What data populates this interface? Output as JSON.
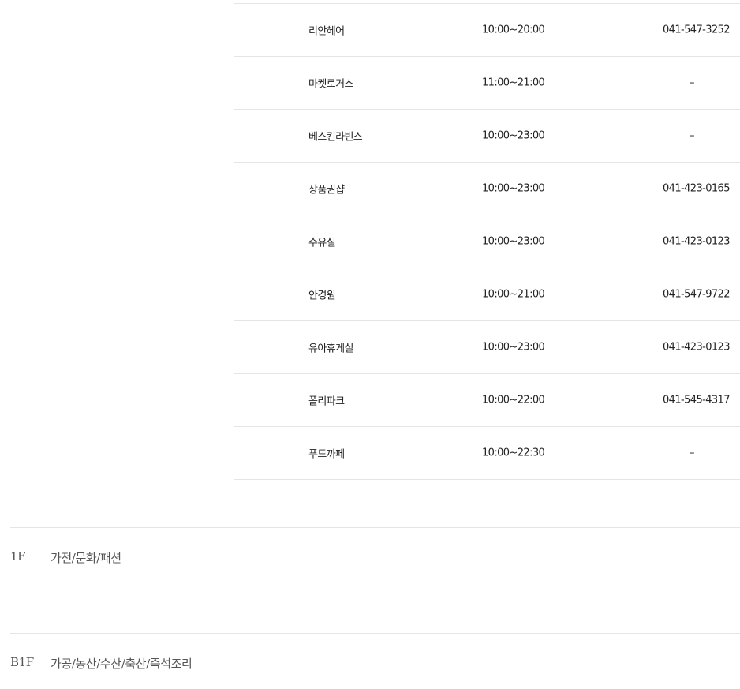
{
  "stores": [
    {
      "name": "리안헤어",
      "hours": "10:00~20:00",
      "phone": "041-547-3252"
    },
    {
      "name": "마켓로거스",
      "hours": "11:00~21:00",
      "phone": "–"
    },
    {
      "name": "베스킨라빈스",
      "hours": "10:00~23:00",
      "phone": "–"
    },
    {
      "name": "상품권샵",
      "hours": "10:00~23:00",
      "phone": "041-423-0165"
    },
    {
      "name": "수유실",
      "hours": "10:00~23:00",
      "phone": "041-423-0123"
    },
    {
      "name": "안경원",
      "hours": "10:00~21:00",
      "phone": "041-547-9722"
    },
    {
      "name": "유아휴게실",
      "hours": "10:00~23:00",
      "phone": "041-423-0123"
    },
    {
      "name": "폴리파크",
      "hours": "10:00~22:00",
      "phone": "041-545-4317"
    },
    {
      "name": "푸드까페",
      "hours": "10:00~22:30",
      "phone": "–"
    }
  ],
  "floors": [
    {
      "code": "1F",
      "desc": "가전/문화/패션"
    },
    {
      "code": "B1F",
      "desc": "가공/농산/수산/축산/즉석조리"
    }
  ]
}
